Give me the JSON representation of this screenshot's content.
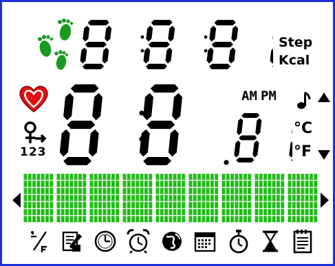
{
  "screen": {
    "border_color": "#1c30d8",
    "segment_color": "#000000",
    "accent_green": "#1a9a20",
    "heart_color": "#e01010",
    "bar_color": "#22bb18"
  },
  "step_display": {
    "digits": 6,
    "units": [
      "Step",
      "Kcal"
    ]
  },
  "time_display": {
    "big_digits": 4,
    "small_digits": 2,
    "ampm": [
      "AM",
      "PM"
    ],
    "temp_units": [
      "°C",
      "°F"
    ],
    "user_number": "123"
  },
  "indicators": {
    "footprints_icon": "footprints-icon",
    "heart_icon": "heart-icon",
    "user_icon": "user-gender-icon",
    "note_icon": "music-note-icon",
    "up_icon": "arrow-up-icon",
    "down_icon": "arrow-down-icon"
  },
  "progress_bar": {
    "segments": 9,
    "rows": 7,
    "cols": 7,
    "fill": 1.0
  },
  "bottom_icons": [
    "temperature-icon",
    "edit-notes-icon",
    "clock-icon",
    "alarm-clock-icon",
    "globe-icon",
    "calendar-icon",
    "stopwatch-icon",
    "hourglass-icon",
    "notepad-icon"
  ]
}
